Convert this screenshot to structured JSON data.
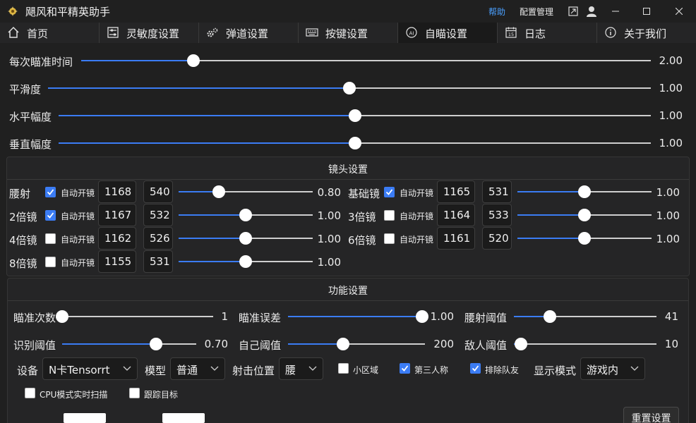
{
  "app": {
    "title": "飓风和平精英助手",
    "help": "帮助",
    "config": "配置管理"
  },
  "tabs": [
    {
      "label": "首页",
      "icon": "home-icon"
    },
    {
      "label": "灵敏度设置",
      "icon": "sliders-icon"
    },
    {
      "label": "弹道设置",
      "icon": "gears-icon"
    },
    {
      "label": "按键设置",
      "icon": "keyboard-icon"
    },
    {
      "label": "自瞄设置",
      "icon": "ai-icon",
      "active": true
    },
    {
      "label": "日志",
      "icon": "calendar-icon"
    },
    {
      "label": "关于我们",
      "icon": "info-icon"
    }
  ],
  "top_sliders": [
    {
      "label": "每次瞄准时间",
      "value": 2.0,
      "display": "2.00",
      "fraction": 0.197
    },
    {
      "label": "平滑度",
      "value": 1.0,
      "display": "1.00",
      "fraction": 0.5
    },
    {
      "label": "水平幅度",
      "value": 1.0,
      "display": "1.00",
      "fraction": 0.5
    },
    {
      "label": "垂直幅度",
      "value": 1.0,
      "display": "1.00",
      "fraction": 0.5
    }
  ],
  "scope": {
    "title": "镜头设置",
    "auto_label": "自动开镜",
    "items": [
      {
        "label": "腰射",
        "auto": true,
        "x": "1168",
        "y": "540",
        "value": "0.80",
        "fraction": 0.3
      },
      {
        "label": "基础镜",
        "auto": true,
        "x": "1165",
        "y": "531",
        "value": "1.00",
        "fraction": 0.5
      },
      {
        "label": "2倍镜",
        "auto": true,
        "x": "1167",
        "y": "532",
        "value": "1.00",
        "fraction": 0.5
      },
      {
        "label": "3倍镜",
        "auto": false,
        "x": "1164",
        "y": "533",
        "value": "1.00",
        "fraction": 0.5
      },
      {
        "label": "4倍镜",
        "auto": false,
        "x": "1162",
        "y": "526",
        "value": "1.00",
        "fraction": 0.5
      },
      {
        "label": "6倍镜",
        "auto": false,
        "x": "1161",
        "y": "520",
        "value": "1.00",
        "fraction": 0.5
      },
      {
        "label": "8倍镜",
        "auto": false,
        "x": "1155",
        "y": "531",
        "value": "1.00",
        "fraction": 0.5
      }
    ]
  },
  "func": {
    "title": "功能设置",
    "sliders": [
      {
        "label": "瞄准次数",
        "value": "1",
        "fraction": 0.0
      },
      {
        "label": "瞄准误差",
        "value": "1.00",
        "fraction": 1.0
      },
      {
        "label": "腰射阈值",
        "value": "41",
        "fraction": 0.25
      },
      {
        "label": "识别阈值",
        "value": "0.70",
        "fraction": 0.7
      },
      {
        "label": "自己阈值",
        "value": "200",
        "fraction": 0.4
      },
      {
        "label": "敌人阈值",
        "value": "10",
        "fraction": 0.05
      }
    ],
    "device_label": "设备",
    "device_value": "N卡Tensorrt",
    "model_label": "模型",
    "model_value": "普通",
    "pos_label": "射击位置",
    "pos_value": "腰",
    "small_area": {
      "label": "小区域",
      "checked": false
    },
    "third_person": {
      "label": "第三人称",
      "checked": true
    },
    "exclude_team": {
      "label": "排除队友",
      "checked": true
    },
    "display_label": "显示模式",
    "display_value": "游戏内",
    "cpu_scan": {
      "label": "CPU模式实时扫描",
      "checked": false
    },
    "track": {
      "label": "跟踪目标",
      "checked": false
    },
    "reset": "重置设置"
  },
  "colors": {
    "accent": "#3b7cf4",
    "bg": "#202020",
    "panel": "#252526"
  }
}
